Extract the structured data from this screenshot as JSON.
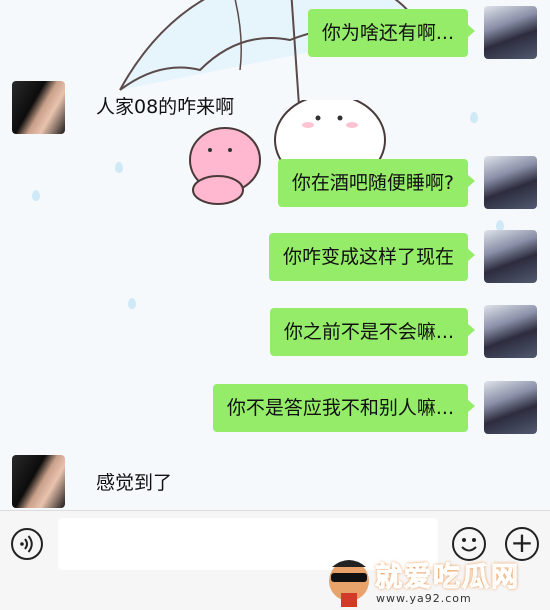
{
  "messages": [
    {
      "side": "right",
      "text": "你为啥还有啊...",
      "avatar": "my-avatar"
    },
    {
      "side": "left",
      "text": "人家08的咋来啊",
      "avatar": "contact-avatar"
    },
    {
      "side": "right",
      "text": "你在酒吧随便睡啊?",
      "avatar": "my-avatar"
    },
    {
      "side": "right",
      "text": "你咋变成这样了现在",
      "avatar": "my-avatar"
    },
    {
      "side": "right",
      "text": "你之前不是不会嘛...",
      "avatar": "my-avatar"
    },
    {
      "side": "right",
      "text": "你不是答应我不和别人嘛...",
      "avatar": "my-avatar"
    },
    {
      "side": "left",
      "text": "感觉到了",
      "avatar": "contact-avatar"
    }
  ],
  "input_bar": {
    "input_value": "",
    "voice_icon": "voice-icon",
    "emoji_icon": "emoji-icon",
    "plus_icon": "plus-icon"
  },
  "watermark": {
    "title": "就爱吃瓜网",
    "url": "www.ya92.com"
  },
  "colors": {
    "bubble_green": "#95ec69",
    "background": "#f5f9fc",
    "watermark_orange": "#ff9d2e"
  }
}
